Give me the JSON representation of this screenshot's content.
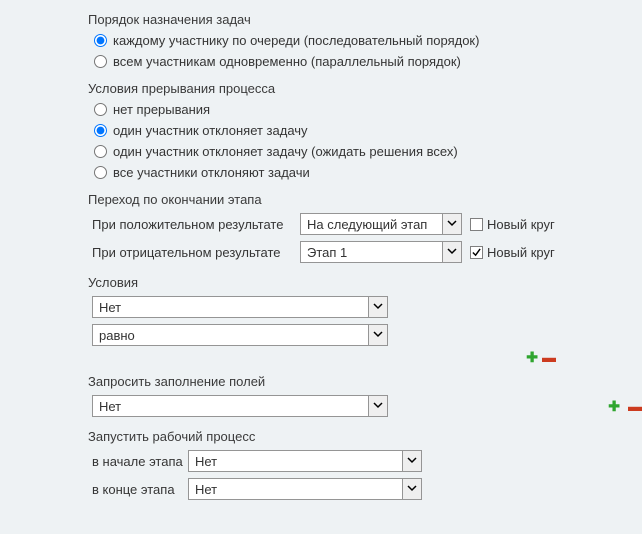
{
  "section_order": {
    "title": "Порядок назначения задач",
    "options": [
      "каждому участнику по очереди (последовательный порядок)",
      "всем участникам одновременно (параллельный порядок)"
    ],
    "selected": 0
  },
  "section_interrupt": {
    "title": "Условия прерывания процесса",
    "options": [
      "нет прерывания",
      "один участник отклоняет задачу",
      "один участник отклоняет задачу (ожидать решения всех)",
      "все участники отклоняют задачи"
    ],
    "selected": 1
  },
  "section_transition": {
    "title": "Переход по окончании этапа",
    "positive_label": "При положительном результате",
    "positive_value": "На следующий этап",
    "positive_newround": false,
    "negative_label": "При отрицательном результате",
    "negative_value": "Этап 1",
    "negative_newround": true,
    "newround_label": "Новый круг"
  },
  "section_conditions": {
    "title": "Условия",
    "field_value": "Нет",
    "op_value": "равно"
  },
  "section_request": {
    "title": "Запросить заполнение полей",
    "value": "Нет"
  },
  "section_run": {
    "title": "Запустить рабочий процесс",
    "start_label": "в начале этапа",
    "start_value": "Нет",
    "end_label": "в конце этапа",
    "end_value": "Нет"
  }
}
